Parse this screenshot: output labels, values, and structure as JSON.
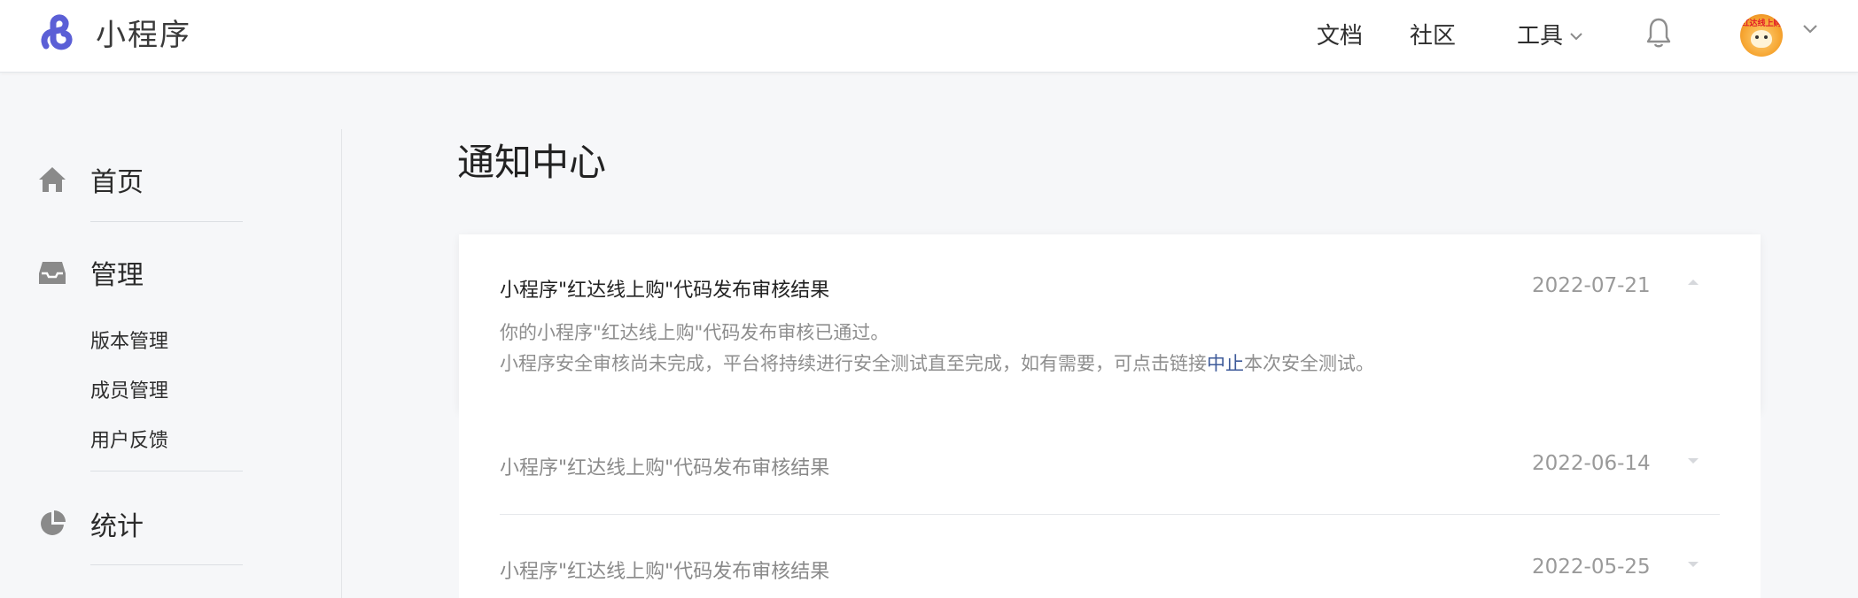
{
  "header": {
    "app_name": "小程序",
    "nav": {
      "docs": "文档",
      "community": "社区",
      "tools": "工具"
    },
    "avatar_text": "红达线上购"
  },
  "sidebar": {
    "home": "首页",
    "manage": "管理",
    "manage_sub": [
      "版本管理",
      "成员管理",
      "用户反馈"
    ],
    "stats": "统计"
  },
  "main": {
    "title": "通知中心",
    "notifications": [
      {
        "title": "小程序\"红达线上购\"代码发布审核结果",
        "date": "2022-07-21",
        "expanded": true,
        "body_line1": "你的小程序\"红达线上购\"代码发布审核已通过。",
        "body_line2_before": "小程序安全审核尚未完成，平台将持续进行安全测试直至完成，如有需要，可点击链接",
        "body_link": "中止",
        "body_line2_after": "本次安全测试。"
      },
      {
        "title": "小程序\"红达线上购\"代码发布审核结果",
        "date": "2022-06-14",
        "expanded": false
      },
      {
        "title": "小程序\"红达线上购\"代码发布审核结果",
        "date": "2022-05-25",
        "expanded": false
      }
    ]
  },
  "colors": {
    "accent": "#5b5fd6",
    "link": "#3d5a99",
    "icon_gray": "#8a8a8a"
  }
}
